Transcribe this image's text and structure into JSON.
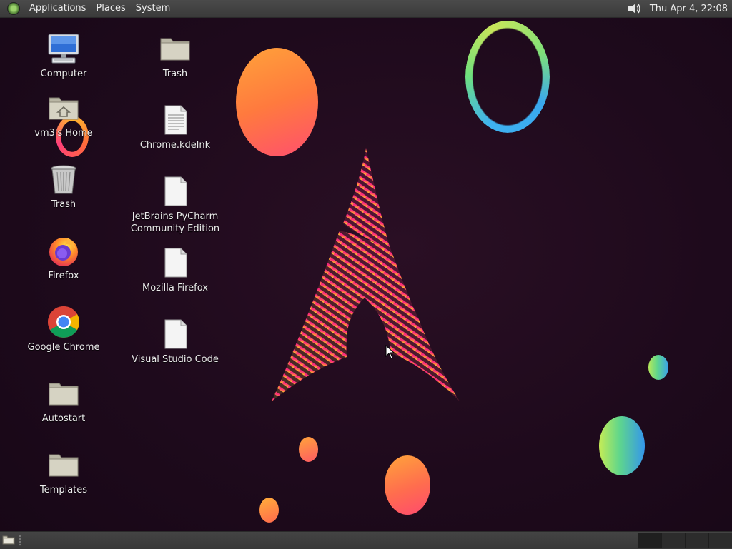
{
  "top_panel": {
    "menus": [
      "Applications",
      "Places",
      "System"
    ],
    "clock": "Thu Apr  4, 22:08"
  },
  "desktop": {
    "icons": [
      {
        "label": "Computer",
        "icon": "computer-icon"
      },
      {
        "label": "vm3's Home",
        "icon": "home-folder-icon"
      },
      {
        "label": "Trash",
        "icon": "trash-icon"
      },
      {
        "label": "Firefox",
        "icon": "firefox-icon"
      },
      {
        "label": "Google Chrome",
        "icon": "chrome-icon"
      },
      {
        "label": "Autostart",
        "icon": "folder-icon"
      },
      {
        "label": "Templates",
        "icon": "folder-icon"
      },
      {
        "label": "Trash",
        "icon": "folder-icon"
      },
      {
        "label": "Chrome.kdelnk",
        "icon": "text-file-icon"
      },
      {
        "label": "JetBrains PyCharm Community Edition",
        "icon": "file-icon"
      },
      {
        "label": "Mozilla Firefox",
        "icon": "file-icon"
      },
      {
        "label": "Visual Studio Code",
        "icon": "file-icon"
      }
    ]
  },
  "colors": {
    "background": "#1e0a1c",
    "panel": "#3a3a3a",
    "accent_pink": "#ff2f7a",
    "accent_orange": "#ff8c3a"
  }
}
